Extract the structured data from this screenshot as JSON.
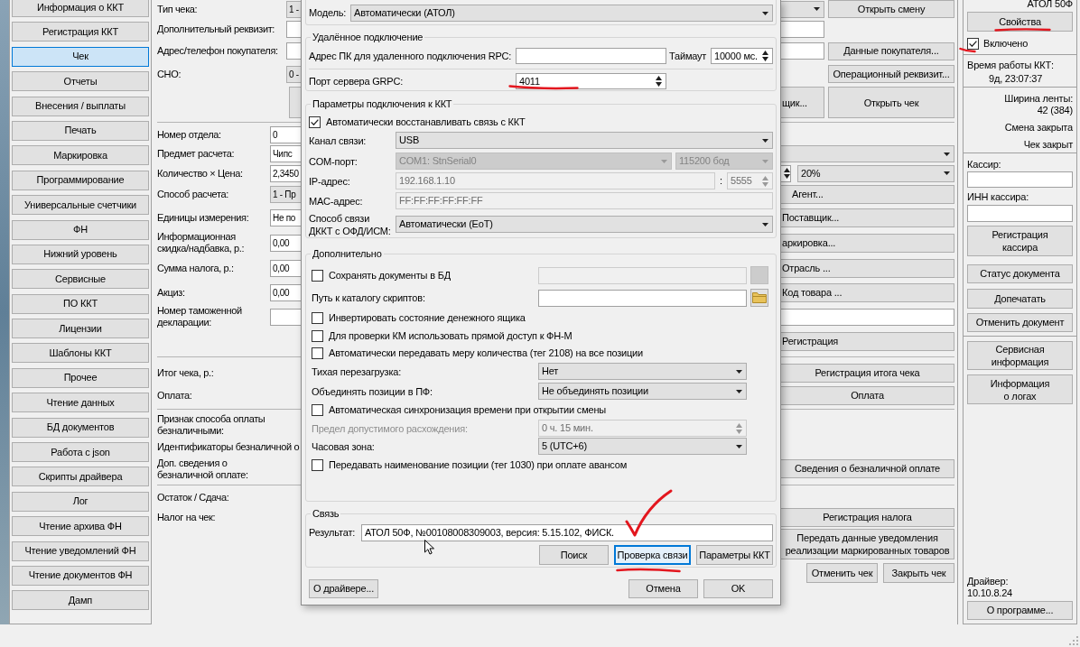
{
  "sidebar": {
    "items": [
      {
        "label": "Информация о ККТ",
        "selected": false
      },
      {
        "label": "Регистрация ККТ",
        "selected": false
      },
      {
        "label": "Чек",
        "selected": true
      },
      {
        "label": "Отчеты",
        "selected": false
      },
      {
        "label": "Внесения / выплаты",
        "selected": false
      },
      {
        "label": "Печать",
        "selected": false
      },
      {
        "label": "Маркировка",
        "selected": false
      },
      {
        "label": "Программирование",
        "selected": false
      },
      {
        "label": "Универсальные счетчики",
        "selected": false
      },
      {
        "label": "ФН",
        "selected": false
      },
      {
        "label": "Нижний уровень",
        "selected": false
      },
      {
        "label": "Сервисные",
        "selected": false
      },
      {
        "label": "ПО ККТ",
        "selected": false
      },
      {
        "label": "Лицензии",
        "selected": false
      },
      {
        "label": "Шаблоны ККТ",
        "selected": false
      },
      {
        "label": "Прочее",
        "selected": false
      },
      {
        "label": "Чтение данных",
        "selected": false
      },
      {
        "label": "БД документов",
        "selected": false
      },
      {
        "label": "Работа с json",
        "selected": false
      },
      {
        "label": "Скрипты драйвера",
        "selected": false
      },
      {
        "label": "Лог",
        "selected": false
      },
      {
        "label": "Чтение архива ФН",
        "selected": false
      },
      {
        "label": "Чтение уведомлений ФН",
        "selected": false
      },
      {
        "label": "Чтение документов ФН",
        "selected": false
      },
      {
        "label": "Дамп",
        "selected": false
      }
    ]
  },
  "receipt_form": {
    "sections": [
      {
        "rows": [
          {
            "label": "Тип чека:",
            "field": {
              "kind": "combo",
              "value": "1 -"
            },
            "right": [
              {
                "kind": "combo"
              },
              {
                "kind": "button",
                "label": "Открыть смену"
              }
            ]
          },
          {
            "label": "Дополнительный реквизит:",
            "field": {
              "kind": "input"
            },
            "right": [
              {
                "kind": "input"
              }
            ]
          },
          {
            "label": "Адрес/телефон покупателя:",
            "field": {
              "kind": "input"
            },
            "right": [
              {
                "kind": "input"
              },
              {
                "kind": "button",
                "label": "Данные покупателя..."
              }
            ]
          },
          {
            "label": "СНО:",
            "field": {
              "kind": "combo",
              "value": "0 -"
            },
            "right": [
              {
                "kind": "button",
                "label": "Операционный реквизит..."
              }
            ]
          },
          {
            "field": {
              "kind": "button"
            },
            "right": [
              {
                "kind": "button",
                "label": "щик..."
              },
              {
                "kind": "button",
                "label": "Открыть чек"
              }
            ]
          }
        ]
      },
      {
        "rows": [
          {
            "label": "Номер отдела:",
            "field": {
              "kind": "input",
              "value": "0"
            }
          },
          {
            "label": "Предмет расчета:",
            "field": {
              "kind": "input",
              "value": "Чипс"
            },
            "right": [
              {
                "kind": "combo"
              }
            ]
          },
          {
            "label": "Количество × Цена:",
            "field": {
              "kind": "input",
              "value": "2,3450"
            },
            "right": [
              {
                "kind": "spin"
              },
              {
                "kind": "combo",
                "value": "20%"
              }
            ]
          },
          {
            "label": "Способ расчета:",
            "field": {
              "kind": "combo",
              "value": "1 - Пр"
            },
            "right": [
              {
                "kind": "button",
                "label": "Агент..."
              }
            ]
          },
          {
            "label": "Единицы измерения:",
            "field": {
              "kind": "input",
              "value": "Не по"
            },
            "right": [
              {
                "kind": "button",
                "label": "Поставщик..."
              }
            ]
          },
          {
            "label": "Информационная\nскидка/надбавка, р.:",
            "field": {
              "kind": "input",
              "value": "0,00"
            },
            "right": [
              {
                "kind": "button",
                "label": "аркировка..."
              }
            ]
          },
          {
            "label": "Сумма налога, р.:",
            "field": {
              "kind": "input",
              "value": "0,00"
            },
            "right": [
              {
                "kind": "button",
                "label": "Отрасль ..."
              }
            ]
          },
          {
            "label": "Акциз:",
            "field": {
              "kind": "input",
              "value": "0,00"
            },
            "right": [
              {
                "kind": "button",
                "label": "Код товара ..."
              }
            ]
          },
          {
            "label": "Номер таможенной\nдекларации:",
            "field": {
              "kind": "input"
            },
            "right": [
              {
                "kind": "input"
              }
            ]
          },
          {
            "right": [
              {
                "kind": "button",
                "label": "Регистрация"
              }
            ]
          }
        ]
      },
      {
        "rows": [
          {
            "label": "Итог чека, р.:",
            "right": [
              {
                "kind": "button",
                "label": "Регистрация итога чека"
              }
            ]
          },
          {
            "label": "Оплата:",
            "right": [
              {
                "kind": "button",
                "label": "Оплата"
              }
            ]
          }
        ]
      },
      {
        "rows": [
          {
            "label": "Признак способа оплаты\nбезналичными:"
          },
          {
            "label": "Идентификаторы безналичной о"
          },
          {
            "label": "Доп. сведения о\nбезналичной оплате:",
            "right": [
              {
                "kind": "button",
                "label": "Сведения о безналичной оплате"
              }
            ]
          }
        ]
      },
      {
        "rows": [
          {
            "label": "Остаток / Сдача:"
          },
          {
            "label": "Налог на чек:",
            "right": [
              {
                "kind": "button",
                "label": "Регистрация налога"
              }
            ]
          },
          {
            "right": [
              {
                "kind": "button",
                "label": "Передать данные уведомления\nреализации маркированных товаров"
              }
            ]
          }
        ]
      }
    ],
    "footer_buttons": [
      "Отменить чек",
      "Закрыть чек"
    ]
  },
  "settings_dialog": {
    "model": {
      "label": "Модель:",
      "value": "Автоматически (АТОЛ)"
    },
    "remote_connection": {
      "title": "Удалённое подключение",
      "rpc_address": {
        "label": "Адрес ПК для удаленного подключения RPC:"
      },
      "timeout": {
        "label": "Таймаут",
        "value": "10000 мс."
      },
      "grpc_port": {
        "label": "Порт сервера GRPC:",
        "value": "4011"
      }
    },
    "connection_params": {
      "title": "Параметры подключения к ККТ",
      "rows": [
        {
          "kind": "checkbox",
          "label": "Автоматически восстанавливать связь с ККТ",
          "checked": true,
          "disabled": false
        },
        {
          "kind": "field",
          "label": "Канал связи:",
          "disabled": false,
          "fields": [
            {
              "kind": "combo",
              "value": "USB",
              "disabled": false
            }
          ]
        },
        {
          "kind": "field",
          "label": "COM-порт:",
          "disabled": false,
          "fields": [
            {
              "kind": "combo",
              "value": "COM1: StnSerial0",
              "disabled": true
            },
            {
              "kind": "combo",
              "value": "115200 бод",
              "disabled": true
            }
          ]
        },
        {
          "kind": "field",
          "label": "IP-адрес:",
          "disabled": false,
          "fields": [
            {
              "kind": "input",
              "value": "192.168.1.10",
              "disabled": true
            },
            {
              "kind": "text",
              "value": ":"
            },
            {
              "kind": "spin",
              "value": "5555",
              "disabled": true
            }
          ]
        },
        {
          "kind": "field",
          "label": "MAC-адрес:",
          "disabled": false,
          "fields": [
            {
              "kind": "input",
              "value": "FF:FF:FF:FF:FF:FF",
              "disabled": true
            }
          ]
        },
        {
          "kind": "field",
          "label": "Способ связи\nДККТ с ОФД/ИСМ:",
          "disabled": false,
          "fields": [
            {
              "kind": "combo",
              "value": "Автоматически (ЕоТ)",
              "disabled": false
            }
          ]
        }
      ]
    },
    "additional": {
      "title": "Дополнительно",
      "rows": [
        {
          "kind": "checkbox",
          "label": "Сохранять документы в БД",
          "checked": false,
          "disabled": false,
          "fields": [
            {
              "kind": "input",
              "disabled": true
            },
            {
              "kind": "button",
              "disabled": true
            }
          ]
        },
        {
          "kind": "field",
          "label": "Путь к каталогу скриптов:",
          "disabled": false,
          "fields": [
            {
              "kind": "input",
              "disabled": false
            },
            {
              "kind": "button",
              "disabled": false
            }
          ]
        },
        {
          "kind": "checkbox",
          "label": "Инвертировать состояние денежного ящика",
          "checked": false,
          "disabled": false
        },
        {
          "kind": "checkbox",
          "label": "Для проверки КМ использовать прямой доступ к ФН-М",
          "checked": false,
          "disabled": false
        },
        {
          "kind": "checkbox",
          "label": "Автоматически передавать меру количества (тег 2108) на все позиции",
          "checked": false,
          "disabled": false
        },
        {
          "kind": "field",
          "label": "Тихая перезагрузка:",
          "disabled": false,
          "fields": [
            {
              "kind": "combo",
              "value": "Нет",
              "disabled": false
            }
          ]
        },
        {
          "kind": "field",
          "label": "Объединять позиции в ПФ:",
          "disabled": false,
          "fields": [
            {
              "kind": "combo",
              "value": "Не объединять позиции",
              "disabled": false
            }
          ]
        },
        {
          "kind": "checkbox",
          "label": "Автоматическая синхронизация времени при открытии смены",
          "checked": false,
          "disabled": false
        },
        {
          "kind": "field",
          "label": "Предел допустимого расхождения:",
          "disabled": true,
          "fields": [
            {
              "kind": "spin",
              "value": "0 ч. 15 мин.",
              "disabled": true
            }
          ]
        },
        {
          "kind": "field",
          "label": "Часовая зона:",
          "disabled": false,
          "fields": [
            {
              "kind": "combo",
              "value": "5 (UTC+6)",
              "disabled": false
            }
          ]
        },
        {
          "kind": "checkbox",
          "label": "Передавать наименование позиции (тег 1030) при оплате авансом",
          "checked": false,
          "disabled": false
        }
      ]
    },
    "link": {
      "title": "Связь",
      "result": {
        "label": "Результат:",
        "value": "АТОЛ 50Ф, №00108008309003, версия: 5.15.102, ФИСК."
      },
      "buttons": [
        {
          "label": "Поиск",
          "focused": false
        },
        {
          "label": "Проверка связи",
          "focused": true
        },
        {
          "label": "Параметры ККТ",
          "focused": false
        }
      ]
    },
    "footer_buttons": [
      {
        "label": "О драйвере..."
      },
      {
        "label": "Отмена"
      },
      {
        "label": "OK"
      }
    ]
  },
  "device_panel": {
    "model": "АТОЛ 50Ф",
    "properties_button": "Свойства",
    "enabled": {
      "label": "Включено",
      "checked": true
    },
    "uptime": {
      "label": "Время работы ККТ:",
      "value": "9д, 23:07:37"
    },
    "tape_width": {
      "label": "Ширина ленты:",
      "value": "42 (384)"
    },
    "shift_status": "Смена закрыта",
    "receipt_status": "Чек закрыт",
    "cashier": {
      "label": "Кассир:"
    },
    "cashier_inn": {
      "label": "ИНН кассира:"
    },
    "cashier_button": "Регистрация\nкассира",
    "document_buttons": [
      "Статус документа",
      "Допечатать",
      "Отменить документ"
    ],
    "info_buttons": [
      "Сервисная\nинформация",
      "Информация\nо логах"
    ],
    "driver": {
      "label": "Драйвер:",
      "version": "10.10.8.24"
    },
    "about_button": "О программе..."
  }
}
